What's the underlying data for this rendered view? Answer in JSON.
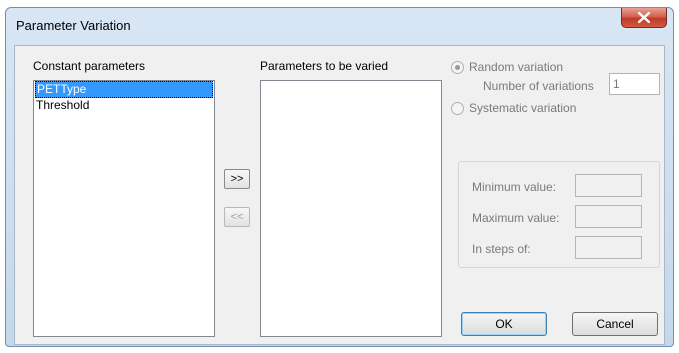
{
  "window": {
    "title": "Parameter Variation"
  },
  "constant": {
    "label": "Constant parameters",
    "items": [
      "PETType",
      "Threshold"
    ],
    "selected_index": 0
  },
  "varied": {
    "label": "Parameters to be varied",
    "items": []
  },
  "buttons": {
    "add": ">>",
    "remove": "<<",
    "ok": "OK",
    "cancel": "Cancel"
  },
  "variation": {
    "random_label": "Random variation",
    "random_selected": true,
    "num_label": "Number of variations",
    "num_value": "1",
    "systematic_label": "Systematic variation",
    "min_label": "Minimum value:",
    "min_value": "",
    "max_label": "Maximum value:",
    "max_value": "",
    "steps_label": "In steps of:",
    "steps_value": ""
  },
  "icons": {
    "close": "close-icon"
  },
  "colors": {
    "selection": "#3399ff",
    "close_button": "#c0392b"
  }
}
